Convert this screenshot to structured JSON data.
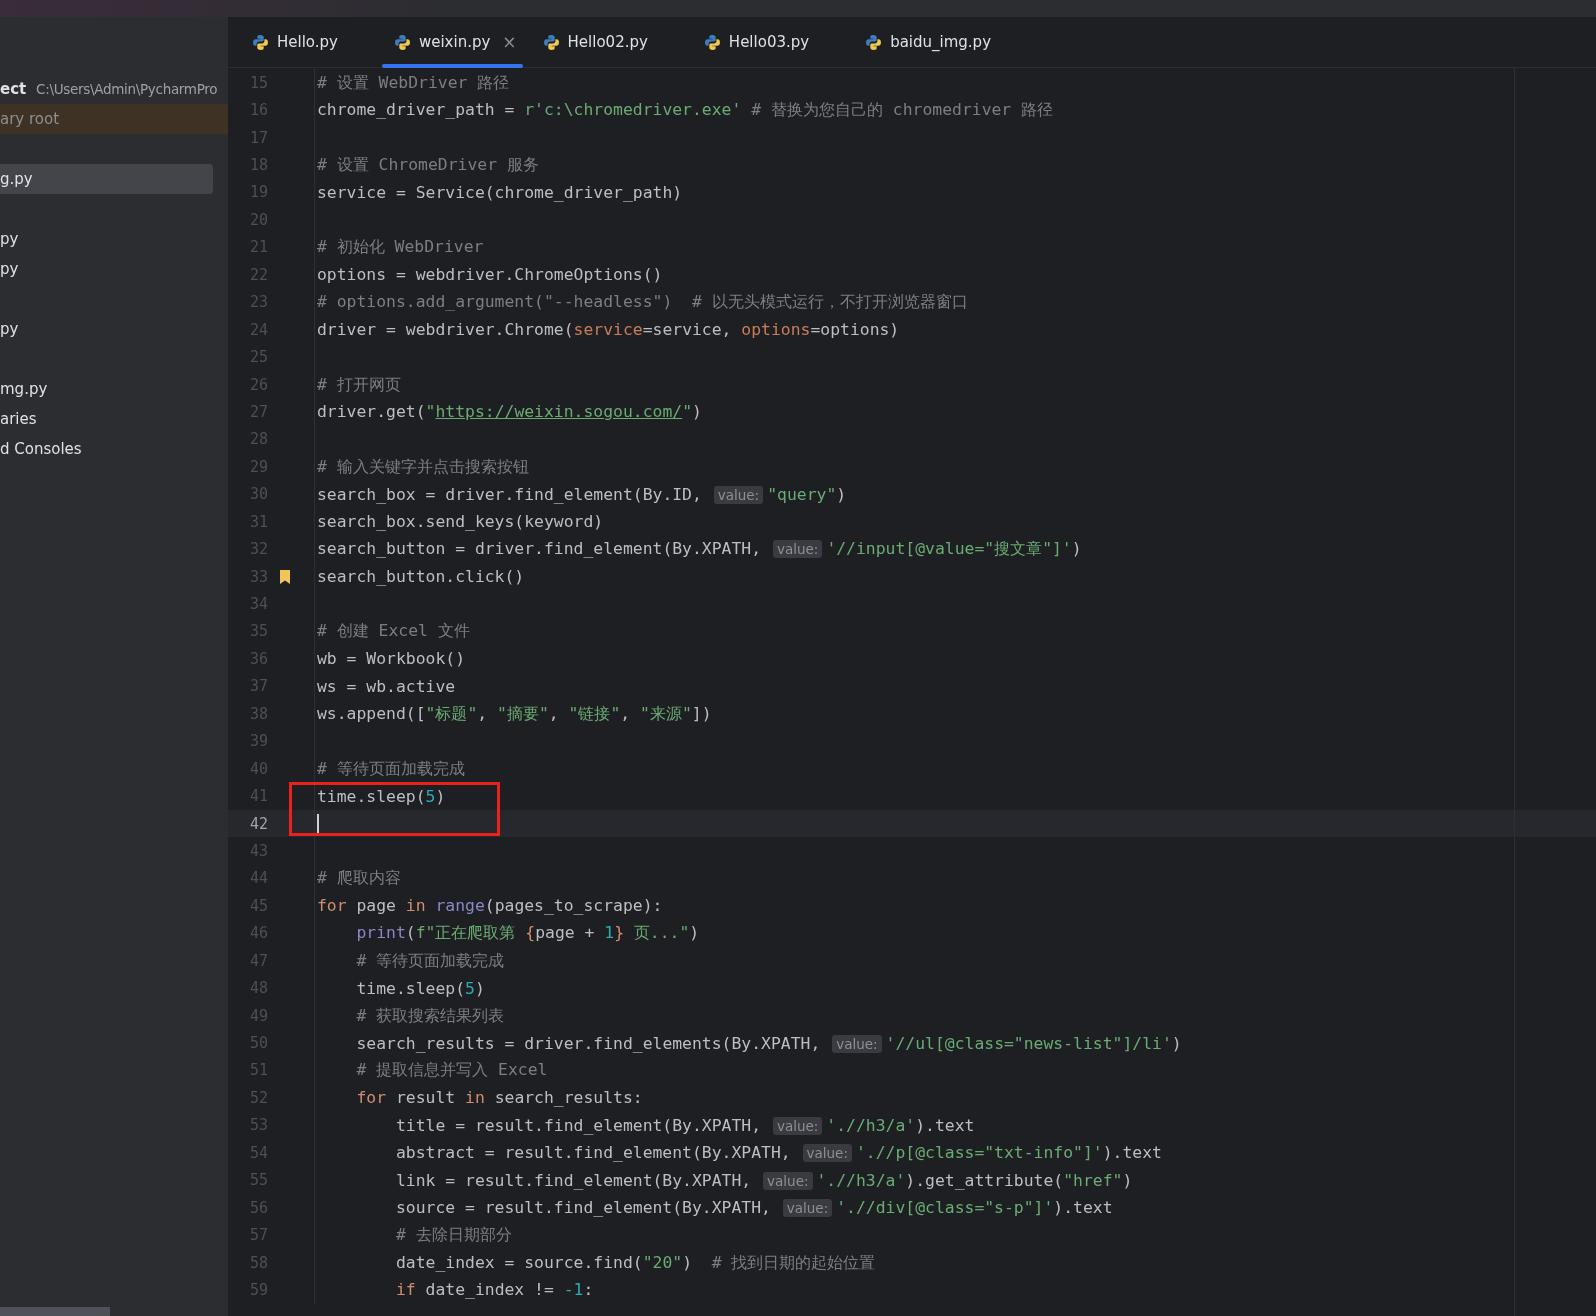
{
  "sidebar": {
    "items": [
      {
        "kind": "project",
        "label": "ect",
        "path": "C:\\Users\\Admin\\PycharmPro",
        "selected": false
      },
      {
        "kind": "root",
        "label": "ary root",
        "selected": false
      },
      {
        "kind": "file",
        "label": "g.py",
        "selected": true
      },
      {
        "kind": "file",
        "label": "py",
        "selected": false
      },
      {
        "kind": "file",
        "label": "py",
        "selected": false
      },
      {
        "kind": "file",
        "label": "py",
        "selected": false
      },
      {
        "kind": "file",
        "label": "mg.py",
        "selected": false
      },
      {
        "kind": "file",
        "label": "aries",
        "selected": false
      },
      {
        "kind": "file",
        "label": "d Consoles",
        "selected": false
      }
    ]
  },
  "tabs": [
    {
      "label": "Hello.py",
      "selected": false
    },
    {
      "label": "weixin.py",
      "selected": true,
      "close": "×"
    },
    {
      "label": "Hello02.py",
      "selected": false
    },
    {
      "label": "Hello03.py",
      "selected": false
    },
    {
      "label": "baidu_img.py",
      "selected": false
    }
  ],
  "annotation": {
    "kind": "rectangle"
  },
  "lines": [
    {
      "number": "15",
      "current": false,
      "bookmark": false,
      "tokens": [
        {
          "kind": "comment",
          "text": "# 设置 WebDriver 路径"
        }
      ]
    },
    {
      "number": "16",
      "current": false,
      "bookmark": false,
      "tokens": [
        {
          "kind": "plain",
          "text": "chrome_driver_path = "
        },
        {
          "kind": "string",
          "text": "r'c:\\chromedriver.exe'"
        },
        {
          "kind": "comment",
          "text": " # 替换为您自己的 chromedriver 路径"
        }
      ]
    },
    {
      "number": "17",
      "current": false,
      "bookmark": false
    },
    {
      "number": "18",
      "current": false,
      "bookmark": false,
      "tokens": [
        {
          "kind": "comment",
          "text": "# 设置 ChromeDriver 服务"
        }
      ]
    },
    {
      "number": "19",
      "current": false,
      "bookmark": false,
      "tokens": [
        {
          "kind": "plain",
          "text": "service = Service(chrome_driver_path)"
        }
      ]
    },
    {
      "number": "20",
      "current": false,
      "bookmark": false
    },
    {
      "number": "21",
      "current": false,
      "bookmark": false,
      "tokens": [
        {
          "kind": "comment",
          "text": "# 初始化 WebDriver"
        }
      ]
    },
    {
      "number": "22",
      "current": false,
      "bookmark": false,
      "tokens": [
        {
          "kind": "plain",
          "text": "options = webdriver.ChromeOptions()"
        }
      ]
    },
    {
      "number": "23",
      "current": false,
      "bookmark": false,
      "tokens": [
        {
          "kind": "comment",
          "text": "# options.add_argument(\"--headless\")  # 以无头模式运行，不打开浏览器窗口"
        }
      ]
    },
    {
      "number": "24",
      "current": false,
      "bookmark": false,
      "tokens": [
        {
          "kind": "plain",
          "text": "driver = webdriver.Chrome("
        },
        {
          "kind": "param",
          "text": "service"
        },
        {
          "kind": "plain",
          "text": "=service, "
        },
        {
          "kind": "param",
          "text": "options"
        },
        {
          "kind": "plain",
          "text": "=options)"
        }
      ]
    },
    {
      "number": "25",
      "current": false,
      "bookmark": false
    },
    {
      "number": "26",
      "current": false,
      "bookmark": false,
      "tokens": [
        {
          "kind": "comment",
          "text": "# 打开网页"
        }
      ]
    },
    {
      "number": "27",
      "current": false,
      "bookmark": false,
      "tokens": [
        {
          "kind": "plain",
          "text": "driver.get("
        },
        {
          "kind": "string",
          "text": "\""
        },
        {
          "kind": "link",
          "text": "https://weixin.sogou.com/"
        },
        {
          "kind": "string",
          "text": "\""
        },
        {
          "kind": "plain",
          "text": ")"
        }
      ]
    },
    {
      "number": "28",
      "current": false,
      "bookmark": false
    },
    {
      "number": "29",
      "current": false,
      "bookmark": false,
      "tokens": [
        {
          "kind": "comment",
          "text": "# 输入关键字并点击搜索按钮"
        }
      ]
    },
    {
      "number": "30",
      "current": false,
      "bookmark": false,
      "tokens": [
        {
          "kind": "plain",
          "text": "search_box = driver.find_element(By.ID, "
        },
        {
          "kind": "hint",
          "text": "value:"
        },
        {
          "kind": "string",
          "text": "\"query\""
        },
        {
          "kind": "plain",
          "text": ")"
        }
      ]
    },
    {
      "number": "31",
      "current": false,
      "bookmark": false,
      "tokens": [
        {
          "kind": "plain",
          "text": "search_box.send_keys(keyword)"
        }
      ]
    },
    {
      "number": "32",
      "current": false,
      "bookmark": false,
      "tokens": [
        {
          "kind": "plain",
          "text": "search_button = driver.find_element(By.XPATH, "
        },
        {
          "kind": "hint",
          "text": "value:"
        },
        {
          "kind": "string",
          "text": "'//input[@value=\"搜文章\"]'"
        },
        {
          "kind": "plain",
          "text": ")"
        }
      ]
    },
    {
      "number": "33",
      "current": false,
      "bookmark": true,
      "tokens": [
        {
          "kind": "plain",
          "text": "search_button.click()"
        }
      ]
    },
    {
      "number": "34",
      "current": false,
      "bookmark": false
    },
    {
      "number": "35",
      "current": false,
      "bookmark": false,
      "tokens": [
        {
          "kind": "comment",
          "text": "# 创建 Excel 文件"
        }
      ]
    },
    {
      "number": "36",
      "current": false,
      "bookmark": false,
      "tokens": [
        {
          "kind": "plain",
          "text": "wb = Workbook()"
        }
      ]
    },
    {
      "number": "37",
      "current": false,
      "bookmark": false,
      "tokens": [
        {
          "kind": "plain",
          "text": "ws = wb.active"
        }
      ]
    },
    {
      "number": "38",
      "current": false,
      "bookmark": false,
      "tokens": [
        {
          "kind": "plain",
          "text": "ws.append(["
        },
        {
          "kind": "string",
          "text": "\"标题\""
        },
        {
          "kind": "plain",
          "text": ", "
        },
        {
          "kind": "string",
          "text": "\"摘要\""
        },
        {
          "kind": "plain",
          "text": ", "
        },
        {
          "kind": "string",
          "text": "\"链接\""
        },
        {
          "kind": "plain",
          "text": ", "
        },
        {
          "kind": "string",
          "text": "\"来源\""
        },
        {
          "kind": "plain",
          "text": "])"
        }
      ]
    },
    {
      "number": "39",
      "current": false,
      "bookmark": false
    },
    {
      "number": "40",
      "current": false,
      "bookmark": false,
      "tokens": [
        {
          "kind": "comment",
          "text": "# 等待页面加载完成"
        }
      ]
    },
    {
      "number": "41",
      "current": false,
      "bookmark": false,
      "tokens": [
        {
          "kind": "plain",
          "text": "time.sleep("
        },
        {
          "kind": "number",
          "text": "5"
        },
        {
          "kind": "plain",
          "text": ")"
        }
      ]
    },
    {
      "number": "42",
      "current": true,
      "bookmark": false
    },
    {
      "number": "43",
      "current": false,
      "bookmark": false
    },
    {
      "number": "44",
      "current": false,
      "bookmark": false,
      "tokens": [
        {
          "kind": "comment",
          "text": "# 爬取内容"
        }
      ]
    },
    {
      "number": "45",
      "current": false,
      "bookmark": false,
      "tokens": [
        {
          "kind": "keyword",
          "text": "for"
        },
        {
          "kind": "plain",
          "text": " page "
        },
        {
          "kind": "keyword",
          "text": "in "
        },
        {
          "kind": "builtin",
          "text": "range"
        },
        {
          "kind": "plain",
          "text": "(pages_to_scrape):"
        }
      ],
      "children": [
        {
          "number": "46",
          "current": false,
          "bookmark": false,
          "tokens": [
            {
              "kind": "builtin",
              "text": "print"
            },
            {
              "kind": "plain",
              "text": "("
            },
            {
              "kind": "string",
              "text": "f\"正在爬取第 "
            },
            {
              "kind": "keyword",
              "text": "{"
            },
            {
              "kind": "plain",
              "text": "page + "
            },
            {
              "kind": "number",
              "text": "1"
            },
            {
              "kind": "keyword",
              "text": "}"
            },
            {
              "kind": "string",
              "text": " 页...\""
            },
            {
              "kind": "plain",
              "text": ")"
            }
          ]
        },
        {
          "number": "47",
          "current": false,
          "bookmark": false,
          "tokens": [
            {
              "kind": "comment",
              "text": "# 等待页面加载完成"
            }
          ]
        },
        {
          "number": "48",
          "current": false,
          "bookmark": false,
          "tokens": [
            {
              "kind": "plain",
              "text": "time.sleep("
            },
            {
              "kind": "number",
              "text": "5"
            },
            {
              "kind": "plain",
              "text": ")"
            }
          ]
        },
        {
          "number": "49",
          "current": false,
          "bookmark": false,
          "tokens": [
            {
              "kind": "comment",
              "text": "# 获取搜索结果列表"
            }
          ]
        },
        {
          "number": "50",
          "current": false,
          "bookmark": false,
          "tokens": [
            {
              "kind": "plain",
              "text": "search_results = driver.find_elements(By.XPATH, "
            },
            {
              "kind": "hint",
              "text": "value:"
            },
            {
              "kind": "string",
              "text": "'//ul[@class=\"news-list\"]/li'"
            },
            {
              "kind": "plain",
              "text": ")"
            }
          ]
        },
        {
          "number": "51",
          "current": false,
          "bookmark": false,
          "tokens": [
            {
              "kind": "comment",
              "text": "# 提取信息并写入 Excel"
            }
          ]
        },
        {
          "number": "52",
          "current": false,
          "bookmark": false,
          "tokens": [
            {
              "kind": "keyword",
              "text": "for"
            },
            {
              "kind": "plain",
              "text": " result "
            },
            {
              "kind": "keyword",
              "text": "in"
            },
            {
              "kind": "plain",
              "text": " search_results:"
            }
          ],
          "children": [
            {
              "number": "53",
              "current": false,
              "bookmark": false,
              "tokens": [
                {
                  "kind": "plain",
                  "text": "title = result.find_element(By.XPATH, "
                },
                {
                  "kind": "hint",
                  "text": "value:"
                },
                {
                  "kind": "string",
                  "text": "'.//h3/a'"
                },
                {
                  "kind": "plain",
                  "text": ").text"
                }
              ]
            },
            {
              "number": "54",
              "current": false,
              "bookmark": false,
              "tokens": [
                {
                  "kind": "plain",
                  "text": "abstract = result.find_element(By.XPATH, "
                },
                {
                  "kind": "hint",
                  "text": "value:"
                },
                {
                  "kind": "string",
                  "text": "'.//p[@class=\"txt-info\"]'"
                },
                {
                  "kind": "plain",
                  "text": ").text"
                }
              ]
            },
            {
              "number": "55",
              "current": false,
              "bookmark": false,
              "tokens": [
                {
                  "kind": "plain",
                  "text": "link = result.find_element(By.XPATH, "
                },
                {
                  "kind": "hint",
                  "text": "value:"
                },
                {
                  "kind": "string",
                  "text": "'.//h3/a'"
                },
                {
                  "kind": "plain",
                  "text": ").get_attribute("
                },
                {
                  "kind": "string",
                  "text": "\"href\""
                },
                {
                  "kind": "plain",
                  "text": ")"
                }
              ]
            },
            {
              "number": "56",
              "current": false,
              "bookmark": false,
              "tokens": [
                {
                  "kind": "plain",
                  "text": "source = result.find_element(By.XPATH, "
                },
                {
                  "kind": "hint",
                  "text": "value:"
                },
                {
                  "kind": "string",
                  "text": "'.//div[@class=\"s-p\"]'"
                },
                {
                  "kind": "plain",
                  "text": ").text"
                }
              ]
            },
            {
              "number": "57",
              "current": false,
              "bookmark": false,
              "tokens": [
                {
                  "kind": "comment",
                  "text": "# 去除日期部分"
                }
              ]
            },
            {
              "number": "58",
              "current": false,
              "bookmark": false,
              "tokens": [
                {
                  "kind": "plain",
                  "text": "date_index = source.find("
                },
                {
                  "kind": "string",
                  "text": "\"20\""
                },
                {
                  "kind": "plain",
                  "text": ")  "
                },
                {
                  "kind": "comment",
                  "text": "# 找到日期的起始位置"
                }
              ]
            },
            {
              "number": "59",
              "current": false,
              "bookmark": false,
              "tokens": [
                {
                  "kind": "keyword",
                  "text": "if"
                },
                {
                  "kind": "plain",
                  "text": " date_index != "
                },
                {
                  "kind": "number",
                  "text": "-1"
                },
                {
                  "kind": "plain",
                  "text": ":"
                }
              ]
            }
          ]
        }
      ]
    }
  ]
}
